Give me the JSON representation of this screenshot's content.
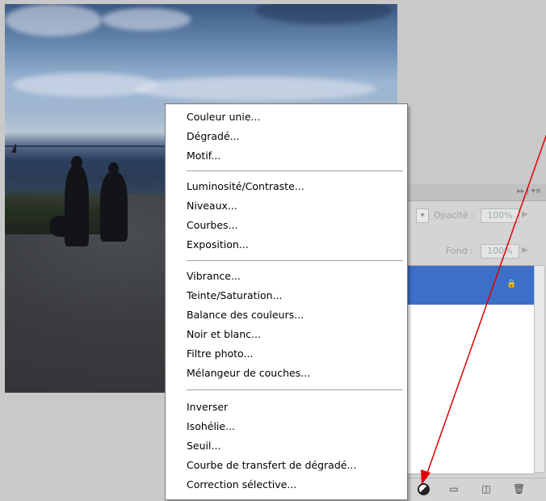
{
  "menu": {
    "group1": [
      "Couleur unie...",
      "Dégradé...",
      "Motif..."
    ],
    "group2": [
      "Luminosité/Contraste...",
      "Niveaux...",
      "Courbes...",
      "Exposition..."
    ],
    "group3": [
      "Vibrance...",
      "Teinte/Saturation...",
      "Balance des couleurs...",
      "Noir et blanc...",
      "Filtre photo...",
      "Mélangeur de couches..."
    ],
    "group4": [
      "Inverser",
      "Isohélie...",
      "Seuil...",
      "Courbe de transfert de dégradé...",
      "Correction sélective..."
    ]
  },
  "layers_panel": {
    "opacity_label": "Opacité :",
    "opacity_value": "100%",
    "fill_label": "Fond :",
    "fill_value": "100%",
    "header_controls": "▸▸ | ▾≡"
  },
  "colors": {
    "selection": "#3c6fc8",
    "arrow": "#e00000"
  },
  "icons": [
    "adjustment-layer-icon",
    "group-folder-icon",
    "new-layer-icon",
    "trash-icon",
    "lock-icon"
  ]
}
